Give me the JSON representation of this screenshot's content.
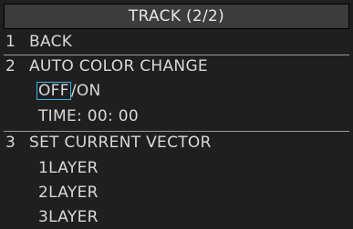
{
  "title": "TRACK (2/2)",
  "items": [
    {
      "number": "1",
      "label": "BACK"
    },
    {
      "number": "2",
      "label": "AUTO COLOR CHANGE"
    },
    {
      "number": "3",
      "label": "SET CURRENT VECTOR"
    }
  ],
  "auto_color_change": {
    "option_off": "OFF",
    "separator": "/",
    "option_on": "ON",
    "selected": "OFF",
    "time": "TIME: 00: 00"
  },
  "current_vector": {
    "layers": [
      "1LAYER",
      "2LAYER",
      "3LAYER"
    ]
  },
  "colors": {
    "background": "#1f1f1f",
    "title_bar": "#3c3c3c",
    "text": "#d9d9d9",
    "selection_cursor": "#34b6e0"
  }
}
